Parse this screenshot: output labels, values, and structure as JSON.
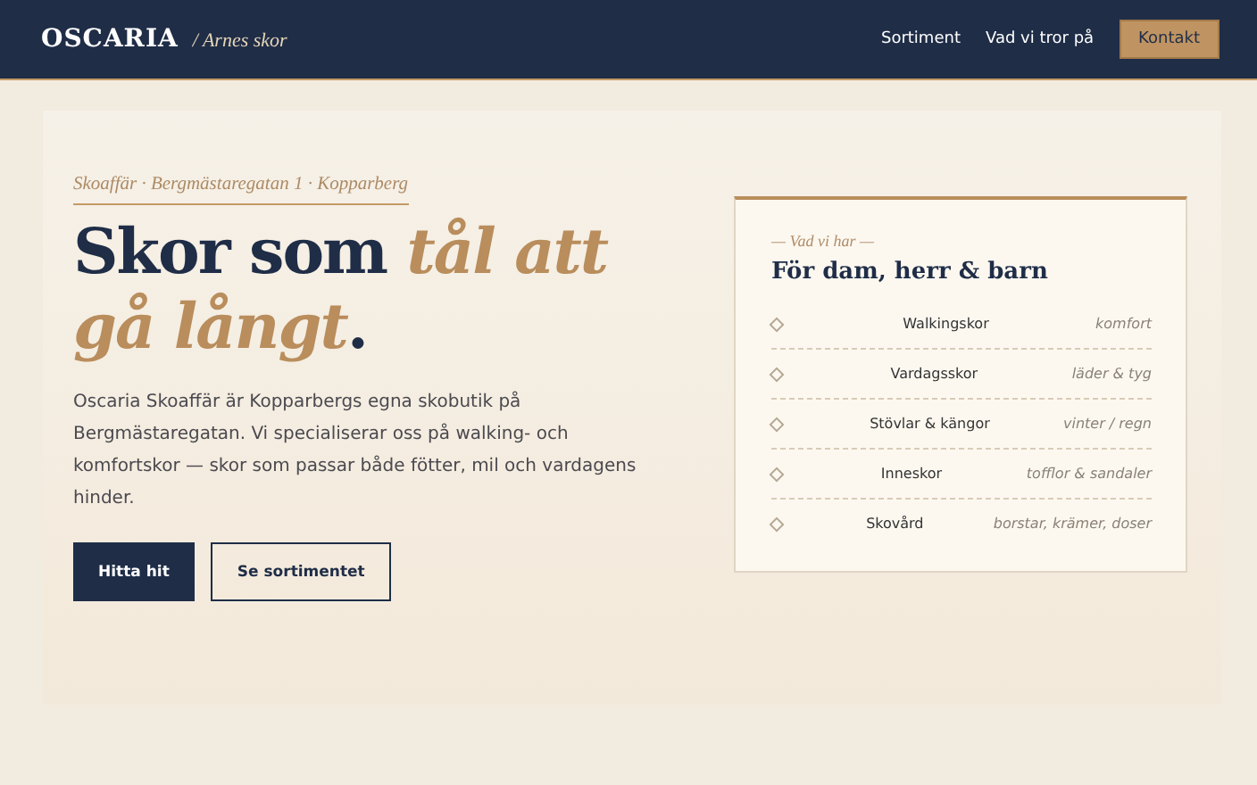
{
  "header": {
    "brand": "OSCARIA",
    "tagline": "/ Arnes skor",
    "nav": [
      "Sortiment",
      "Vad vi tror på"
    ],
    "cta": "Kontakt"
  },
  "hero": {
    "eyebrow": "Skoaffär · Bergmästaregatan 1 · Kopparberg",
    "headline": "Skor som *tål att gå långt*.",
    "body": "Oscaria Skoaffär är Kopparbergs egna skobutik på Bergmästaregatan. Vi specialiserar oss på walking- och komfortskor — skor som passar både fötter, mil och vardagens hinder.",
    "buttons": [
      {
        "label": "Hitta hit",
        "kind": "primary"
      },
      {
        "label": "Se sortimentet",
        "kind": "outline"
      }
    ]
  },
  "card": {
    "eyebrow": "— Vad vi har —",
    "title": "För dam, herr & barn",
    "items": [
      {
        "name": "Walkingskor",
        "note": "komfort"
      },
      {
        "name": "Vardagsskor",
        "note": "läder & tyg"
      },
      {
        "name": "Stövlar & kängor",
        "note": "vinter / regn"
      },
      {
        "name": "Inneskor",
        "note": "tofflor & sandaler"
      },
      {
        "name": "Skovård",
        "note": "borstar, krämer, doser"
      }
    ]
  }
}
